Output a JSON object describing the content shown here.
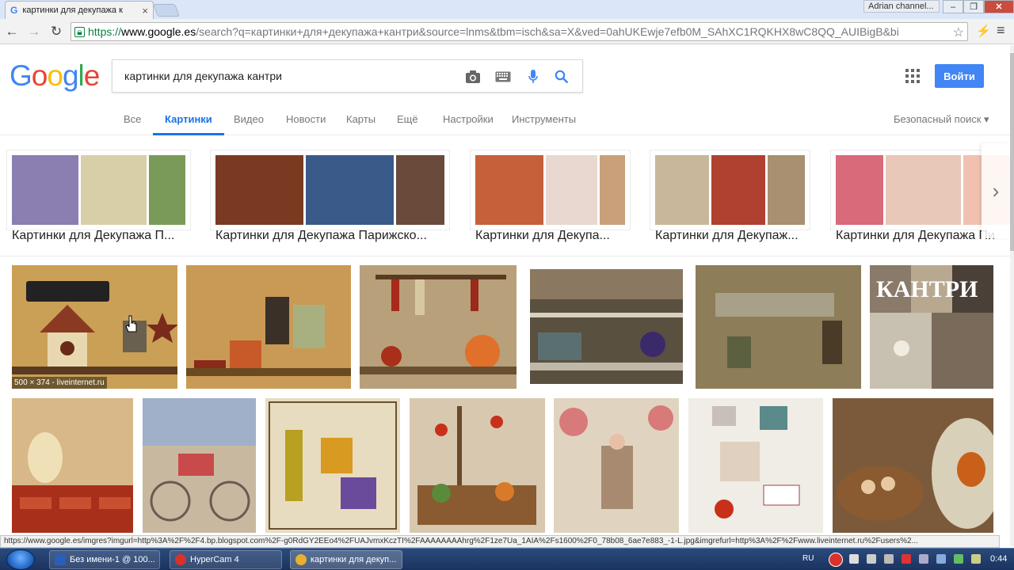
{
  "browser": {
    "tab_title": "картинки для декупажа к",
    "tab_favicon": "G",
    "tab_close": "×",
    "window_owner": "Adrian channel...",
    "url": {
      "scheme": "https://",
      "host": "www.google.es",
      "path": "/search?q=картинки+для+декупажа+кантри&source=lnms&tbm=isch&sa=X&ved=0ahUKEwje7efb0M_SAhXC1RQKHX8wC8QQ_AUIBigB&bi"
    },
    "status_url": "https://www.google.es/imgres?imgurl=http%3A%2F%2F4.bp.blogspot.com%2F-g0RdGY2EEo4%2FUAJvmxKczTI%2FAAAAAAAAhrg%2F1ze7Ua_1AIA%2Fs1600%2F0_78b08_6ae7e883_-1-L.jpg&imgrefurl=http%3A%2F%2Fwww.liveinternet.ru%2Fusers%2..."
  },
  "google": {
    "logo_letters": [
      "G",
      "o",
      "o",
      "g",
      "l",
      "e"
    ],
    "logo_colors": [
      "#4285f4",
      "#ea4335",
      "#fbbc05",
      "#4285f4",
      "#34a853",
      "#ea4335"
    ],
    "query": "картинки для декупажа кантри",
    "login_label": "Войти",
    "tabs": [
      "Все",
      "Картинки",
      "Видео",
      "Новости",
      "Карты",
      "Ещё",
      "Настройки",
      "Инструменты"
    ],
    "active_tab": "Картинки",
    "safe_search": "Безопасный поиск ▾"
  },
  "related": [
    {
      "label": "Картинки для Декупажа П...",
      "colors": [
        "#8a7fb0",
        "#d8cfa8",
        "#7a9a5a"
      ]
    },
    {
      "label": "Картинки для Декупажа Парижско...",
      "colors": [
        "#7a3a22",
        "#3a5a8a",
        "#6a4a3a"
      ]
    },
    {
      "label": "Картинки для Декупа...",
      "colors": [
        "#c5603a",
        "#e8d8d0",
        "#c9a07a"
      ]
    },
    {
      "label": "Картинки для Декупаж...",
      "colors": [
        "#c8b79a",
        "#b04030",
        "#a89070"
      ]
    },
    {
      "label": "Картинки для Декупажа Пи",
      "colors": [
        "#d86a7a",
        "#e8c8b8",
        "#f0c0b0"
      ]
    }
  ],
  "results": [
    {
      "caption": "500 × 374 - liveinternet.ru",
      "color": "#c9a055"
    },
    {
      "caption": "",
      "color": "#c99a55"
    },
    {
      "caption": "",
      "color": "#b8a07a"
    },
    {
      "caption": "",
      "color": "#5a5040"
    },
    {
      "caption": "",
      "color": "#7a6a45"
    },
    {
      "caption": "",
      "color": "#6a5a4a"
    },
    {
      "caption": "",
      "color": "#d8b888"
    },
    {
      "caption": "",
      "color": "#c9b8a0"
    },
    {
      "caption": "",
      "color": "#e8dcc0"
    },
    {
      "caption": "",
      "color": "#d8c8b0"
    },
    {
      "caption": "",
      "color": "#e0d4c0"
    },
    {
      "caption": "",
      "color": "#f0ece6"
    },
    {
      "caption": "",
      "color": "#7a5a3a"
    }
  ],
  "taskbar": {
    "items": [
      {
        "label": "Без имени-1 @ 100...",
        "icon_color": "#2a5fb8"
      },
      {
        "label": "HyperCam 4",
        "icon_color": "#d9322b"
      },
      {
        "label": "картинки для декуп...",
        "icon_color": "#e8b030"
      }
    ],
    "language": "RU",
    "time": "0:44"
  }
}
